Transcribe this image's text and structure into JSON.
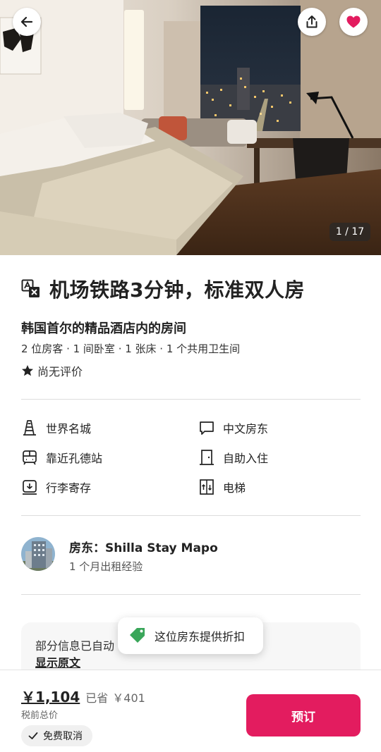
{
  "gallery": {
    "counter": "1 / 17"
  },
  "listing": {
    "title": "机场铁路3分钟，标准双人房",
    "subtitle": "韩国首尔的精品酒店内的房间",
    "details": "2 位房客 · 1 间卧室 · 1 张床 · 1 个共用卫生间",
    "rating": "尚无评价"
  },
  "amenities": [
    {
      "label": "世界名城",
      "icon": "city-tower-icon"
    },
    {
      "label": "中文房东",
      "icon": "chat-bubble-icon"
    },
    {
      "label": "靠近孔德站",
      "icon": "train-icon"
    },
    {
      "label": "自助入住",
      "icon": "door-icon"
    },
    {
      "label": "行李寄存",
      "icon": "luggage-storage-icon"
    },
    {
      "label": "电梯",
      "icon": "elevator-icon"
    }
  ],
  "host": {
    "name": "房东：Shilla Stay Mapo",
    "experience": "1 个月出租经验"
  },
  "translation": {
    "text": "部分信息已自动",
    "show_original": "显示原文"
  },
  "toast": {
    "text": "这位房东提供折扣"
  },
  "footer": {
    "price": "￥1,104",
    "saved_label": "已省",
    "saved_amount": "￥401",
    "tax_note": "税前总价",
    "free_cancel": "免费取消",
    "book_label": "预订"
  },
  "colors": {
    "brand": "#e31c5f",
    "favorite": "#e31c5f",
    "discount_tag": "#3aa65a"
  }
}
